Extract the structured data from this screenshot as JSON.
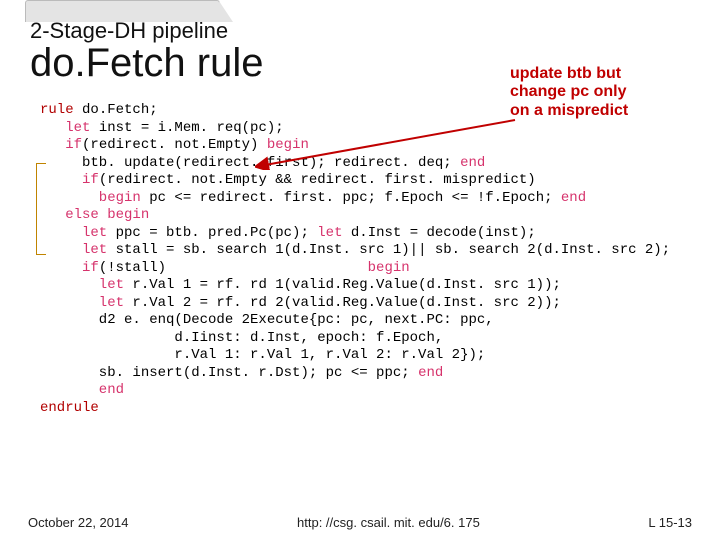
{
  "header": {
    "subtitle": "2-Stage-DH pipeline",
    "title": "do.Fetch rule"
  },
  "annotation": {
    "line1": "update btb but",
    "line2": "change pc only",
    "line3": "on a mispredict"
  },
  "code": {
    "l1a": "rule",
    "l1b": " do.Fetch;",
    "l2a": "   let",
    "l2b": " inst = i.Mem. req(pc);",
    "l3a": "   if",
    "l3b": "(redirect. not.Empty) ",
    "l3c": "begin",
    "l4a": "     btb. update(redirect. first); redirect. deq; ",
    "l4b": "end",
    "l5a": "     if",
    "l5b": "(redirect. not.Empty && redirect. first. mispredict)",
    "l6a": "       begin",
    "l6b": " pc <= redirect. first. ppc; f.Epoch <= !f.Epoch; ",
    "l6c": "end",
    "l7a": "   else begin",
    "l8a": "     let",
    "l8b": " ppc = btb. pred.Pc(pc); ",
    "l8c": "let",
    "l8d": " d.Inst = decode(inst);",
    "l9a": "     let",
    "l9b": " stall = sb. search 1(d.Inst. src 1)|| sb. search 2(d.Inst. src 2);",
    "l10a": "     if",
    "l10b": "(!stall)                        ",
    "l10c": "begin",
    "l11a": "       let",
    "l11b": " r.Val 1 = rf. rd 1(valid.Reg.Value(d.Inst. src 1));",
    "l12a": "       let",
    "l12b": " r.Val 2 = rf. rd 2(valid.Reg.Value(d.Inst. src 2));",
    "l13": "       d2 e. enq(Decode 2Execute{pc: pc, next.PC: ppc,",
    "l14": "                d.Iinst: d.Inst, epoch: f.Epoch,",
    "l15": "                r.Val 1: r.Val 1, r.Val 2: r.Val 2});",
    "l16a": "       sb. insert(d.Inst. r.Dst); pc <= ppc; ",
    "l16b": "end",
    "l17a": "       end",
    "l18a": "endrule"
  },
  "footer": {
    "left": "October 22, 2014",
    "center": "http: //csg. csail. mit. edu/6. 175",
    "right": "L 15-13"
  }
}
